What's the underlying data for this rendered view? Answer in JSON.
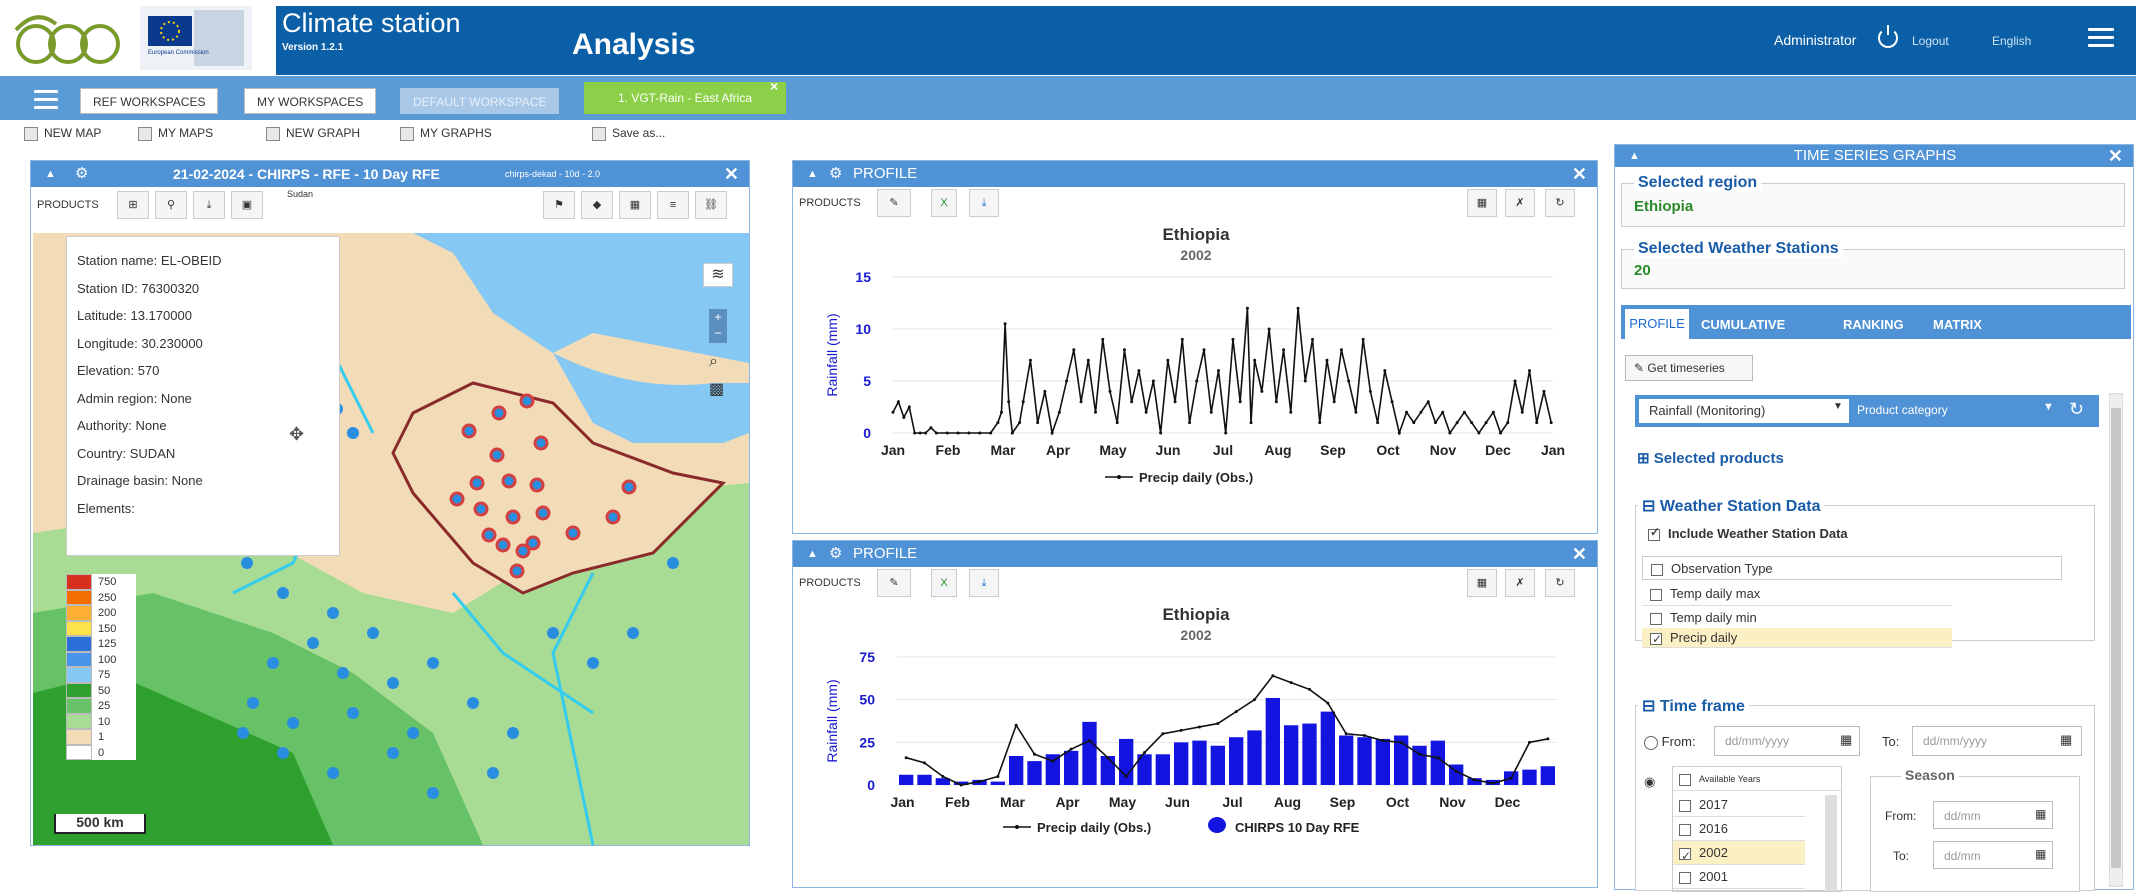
{
  "header": {
    "app_title": "Climate station",
    "version": "Version 1.2.1",
    "page": "Analysis",
    "user": "Administrator",
    "logout": "Logout",
    "language": "English",
    "eu_caption": "European Commission"
  },
  "tabs": {
    "ref": "REF WORKSPACES",
    "my": "MY WORKSPACES",
    "default": "DEFAULT WORKSPACE",
    "active": "1. VGT-Rain - East Africa",
    "close": "×"
  },
  "toolbar": {
    "new_map": "NEW MAP",
    "my_maps": "MY MAPS",
    "new_graph": "NEW GRAPH",
    "my_graphs": "MY GRAPHS",
    "save_as": "Save as..."
  },
  "map": {
    "title": "21-02-2024 - CHIRPS - RFE - 10 Day RFE",
    "subtitle": "chirps-dekad - 10d - 2.0",
    "products": "PRODUCTS",
    "sudan_label": "Sudan",
    "scale": "500 km",
    "info": [
      "Station name: EL-OBEID",
      "Station ID: 76300320",
      "Latitude: 13.170000",
      "Longitude: 30.230000",
      "Elevation: 570",
      "Admin region: None",
      "Authority: None",
      "Country: SUDAN",
      "Drainage basin: None",
      "Elements:"
    ],
    "legend": [
      {
        "v": "750",
        "c": "#d7301f"
      },
      {
        "v": "250",
        "c": "#f46d00"
      },
      {
        "v": "200",
        "c": "#fdae34"
      },
      {
        "v": "150",
        "c": "#fde24a"
      },
      {
        "v": "125",
        "c": "#2a70d8"
      },
      {
        "v": "100",
        "c": "#4a95ec"
      },
      {
        "v": "75",
        "c": "#86c8f4"
      },
      {
        "v": "50",
        "c": "#2ea02e"
      },
      {
        "v": "25",
        "c": "#67c167"
      },
      {
        "v": "10",
        "c": "#a8dc94"
      },
      {
        "v": "1",
        "c": "#f2dcb8"
      },
      {
        "v": "0",
        "c": "#ffffff"
      }
    ]
  },
  "profile1": {
    "head": "PROFILE",
    "products": "PRODUCTS",
    "title": "Ethiopia",
    "subtitle": "2002",
    "ylabel": "Rainfall (mm)",
    "legend": "Precip daily (Obs.)"
  },
  "profile2": {
    "head": "PROFILE",
    "products": "PRODUCTS",
    "title": "Ethiopia",
    "subtitle": "2002",
    "ylabel": "Rainfall (mm)",
    "legend_line": "Precip daily (Obs.)",
    "legend_bar": "CHIRPS 10 Day RFE"
  },
  "chart_data": [
    {
      "type": "line",
      "title": "Ethiopia",
      "subtitle": "2002",
      "xlabel": "",
      "ylabel": "Rainfall (mm)",
      "ylim": [
        0,
        15
      ],
      "yticks": [
        0,
        5,
        10,
        15
      ],
      "xticks": [
        "Jan",
        "Feb",
        "Mar",
        "Apr",
        "May",
        "Jun",
        "Jul",
        "Aug",
        "Sep",
        "Oct",
        "Nov",
        "Dec",
        "Jan"
      ],
      "series": [
        {
          "name": "Precip daily (Obs.)",
          "x_day": [
            0,
            3,
            6,
            9,
            12,
            15,
            18,
            21,
            24,
            30,
            36,
            42,
            48,
            54,
            58,
            60,
            62,
            64,
            66,
            70,
            72,
            76,
            80,
            84,
            88,
            92,
            96,
            100,
            104,
            108,
            112,
            116,
            120,
            124,
            128,
            132,
            136,
            140,
            144,
            148,
            152,
            156,
            160,
            164,
            168,
            172,
            176,
            180,
            184,
            188,
            192,
            196,
            198,
            200,
            204,
            208,
            212,
            216,
            220,
            224,
            228,
            232,
            236,
            240,
            244,
            248,
            252,
            256,
            260,
            264,
            268,
            272,
            276,
            280,
            284,
            288,
            292,
            296,
            300,
            304,
            308,
            312,
            316,
            320,
            324,
            328,
            332,
            336,
            340,
            344,
            348,
            352,
            356,
            360,
            364
          ],
          "y": [
            2,
            3,
            1.5,
            2.5,
            0,
            0,
            0,
            0.5,
            0,
            0,
            0,
            0,
            0,
            0,
            1,
            2,
            10.5,
            3,
            0,
            1,
            3,
            7,
            1,
            4,
            0,
            2,
            5,
            8,
            3,
            7,
            2,
            9,
            4,
            1,
            8,
            3,
            6,
            2,
            5,
            0,
            7,
            3,
            9,
            1,
            5,
            8,
            2,
            6,
            0,
            9,
            3,
            12,
            1,
            7,
            4,
            10,
            3,
            8,
            2,
            12,
            5,
            9,
            1,
            7,
            3,
            8,
            5,
            2,
            9,
            4,
            1,
            6,
            3,
            0,
            2,
            1,
            2,
            3,
            1,
            2,
            0,
            1,
            2,
            1,
            0,
            1,
            2,
            0,
            1,
            5,
            2,
            6,
            1,
            4,
            1
          ]
        }
      ]
    },
    {
      "type": "bar",
      "title": "Ethiopia",
      "subtitle": "2002",
      "xlabel": "",
      "ylabel": "Rainfall (mm)",
      "ylim": [
        0,
        75
      ],
      "yticks": [
        0,
        25,
        50,
        75
      ],
      "xticks": [
        "Jan",
        "Feb",
        "Mar",
        "Apr",
        "May",
        "Jun",
        "Jul",
        "Aug",
        "Sep",
        "Oct",
        "Nov",
        "Dec"
      ],
      "series": [
        {
          "name": "CHIRPS 10 Day RFE",
          "values": [
            6,
            6,
            4,
            2,
            3,
            2,
            17,
            14,
            18,
            20,
            37,
            17,
            27,
            18,
            18,
            25,
            26,
            23,
            28,
            32,
            51,
            35,
            36,
            43,
            29,
            28,
            27,
            29,
            23,
            26,
            12,
            4,
            3,
            8,
            9,
            11
          ]
        },
        {
          "name": "Precip daily (Obs.)",
          "values": [
            16,
            13,
            5,
            0,
            2,
            5,
            35,
            18,
            14,
            21,
            26,
            16,
            5,
            19,
            30,
            32,
            34,
            36,
            43,
            50,
            64,
            60,
            56,
            48,
            30,
            29,
            26,
            25,
            18,
            16,
            8,
            3,
            1,
            4,
            25,
            27
          ]
        }
      ]
    }
  ],
  "ts": {
    "head": "TIME SERIES GRAPHS",
    "sel_region_label": "Selected region",
    "sel_region": "Ethiopia",
    "sel_ws_label": "Selected Weather Stations",
    "sel_ws": "20",
    "tabs": [
      "PROFILE",
      "CUMULATIVE",
      "RANKING",
      "MATRIX"
    ],
    "get_ts": "Get timeseries",
    "category_value": "Rainfall (Monitoring)",
    "category_placeholder": "Product category",
    "sel_products": "Selected products",
    "ws_data": "Weather Station Data",
    "include_ws": "Include Weather Station Data",
    "obs_type": "Observation Type",
    "obs": [
      "Temp daily max",
      "Temp daily min",
      "Precip daily"
    ],
    "time_frame": "Time frame",
    "from": "From:",
    "to": "To:",
    "date_ph": "dd/mm/yyyy",
    "avail_years": "Available Years",
    "years": [
      "2017",
      "2016",
      "2002",
      "2001"
    ],
    "season": "Season",
    "season_from": "From:",
    "season_to": "To:",
    "season_ph": "dd/mm"
  }
}
